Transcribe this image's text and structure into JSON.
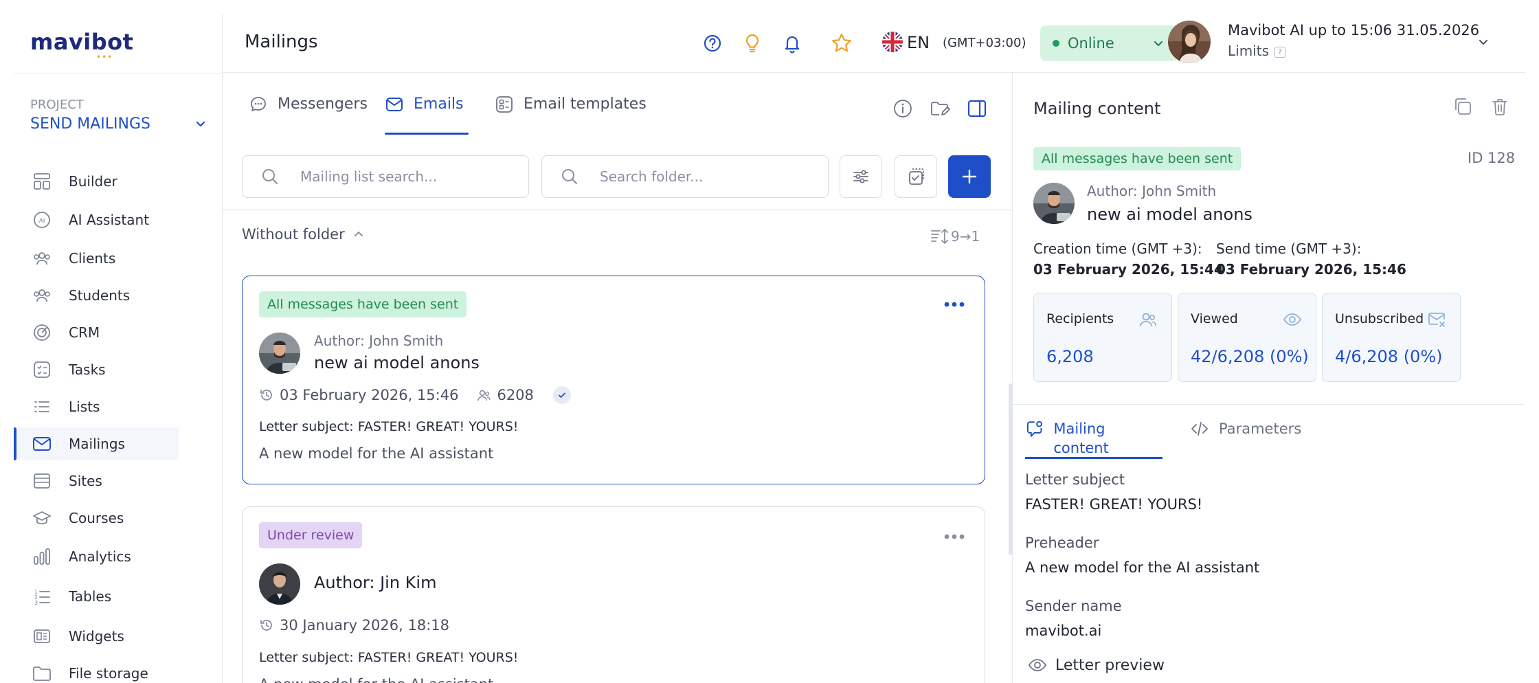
{
  "sidebar": {
    "logo": "mavibot",
    "logo_dots": "•••",
    "project_label": "PROJECT",
    "project_name": "SEND MAILINGS",
    "items": [
      {
        "label": "Builder",
        "icon": "builder-icon"
      },
      {
        "label": "AI Assistant",
        "icon": "ai-icon"
      },
      {
        "label": "Clients",
        "icon": "clients-icon"
      },
      {
        "label": "Students",
        "icon": "students-icon"
      },
      {
        "label": "CRM",
        "icon": "crm-icon"
      },
      {
        "label": "Tasks",
        "icon": "tasks-icon"
      },
      {
        "label": "Lists",
        "icon": "lists-icon"
      },
      {
        "label": "Mailings",
        "icon": "mailings-icon",
        "active": true
      },
      {
        "label": "Sites",
        "icon": "sites-icon"
      },
      {
        "label": "Courses",
        "icon": "courses-icon"
      },
      {
        "label": "Analytics",
        "icon": "analytics-icon"
      },
      {
        "label": "Tables",
        "icon": "tables-icon"
      },
      {
        "label": "Widgets",
        "icon": "widgets-icon"
      },
      {
        "label": "File storage",
        "icon": "folder-icon"
      }
    ]
  },
  "header": {
    "title": "Mailings",
    "language": "EN",
    "timezone": "(GMT+03:00)",
    "status": "Online",
    "plan": "Mavibot AI up to 15:06 31.05.2026",
    "limits": "Limits",
    "limits_help": "?"
  },
  "tabs": [
    {
      "label": "Messengers",
      "icon": "chat-icon"
    },
    {
      "label": "Emails",
      "icon": "mail-icon",
      "active": true
    },
    {
      "label": "Email templates",
      "icon": "template-icon"
    }
  ],
  "search": {
    "mailing_placeholder": "Mailing list search...",
    "folder_placeholder": "Search folder..."
  },
  "list": {
    "folder": "Without folder",
    "sort_label": "9→1"
  },
  "mailings": [
    {
      "status": "All messages have been sent",
      "author": "Author: John Smith",
      "title": "new ai model anons",
      "date": "03 February 2026, 15:46",
      "recipients": "6208",
      "subject": "Letter subject: FASTER! GREAT! YOURS!",
      "preheader": "A new model for the AI assistant"
    },
    {
      "status": "Under review",
      "author": "Author: Jin Kim",
      "date": "30 January 2026, 18:18",
      "subject": "Letter subject: FASTER! GREAT! YOURS!",
      "preheader": "A new model for the AI assistant"
    }
  ],
  "detail": {
    "title": "Mailing content",
    "status": "All messages have been sent",
    "id": "ID 128",
    "author": "Author: John Smith",
    "mailing_title": "new ai model anons",
    "creation_label": "Creation time (GMT +3):",
    "creation_value": "03 February 2026, 15:44",
    "send_label": "Send time (GMT +3):",
    "send_value": "03 February 2026, 15:46",
    "stats": [
      {
        "label": "Recipients",
        "value": "6,208",
        "icon": "users-icon"
      },
      {
        "label": "Viewed",
        "value": "42/6,208 (0%)",
        "icon": "eye-icon"
      },
      {
        "label": "Unsubscribed",
        "value": "4/6,208 (0%)",
        "icon": "mail-x-icon"
      }
    ],
    "tabs": [
      {
        "label": "Mailing content",
        "active": true
      },
      {
        "label": "Parameters"
      }
    ],
    "fields": [
      {
        "label": "Letter subject",
        "value": "FASTER! GREAT! YOURS!"
      },
      {
        "label": "Preheader",
        "value": "A new model for the AI assistant"
      },
      {
        "label": "Sender name",
        "value": "mavibot.ai"
      }
    ],
    "preview_link": "Letter preview"
  },
  "colors": {
    "accent": "#1f4fc8",
    "success_bg": "#cdf2dd",
    "success_text": "#238a52",
    "review_bg": "#e4d4f5",
    "review_text": "#7a4ca6"
  }
}
